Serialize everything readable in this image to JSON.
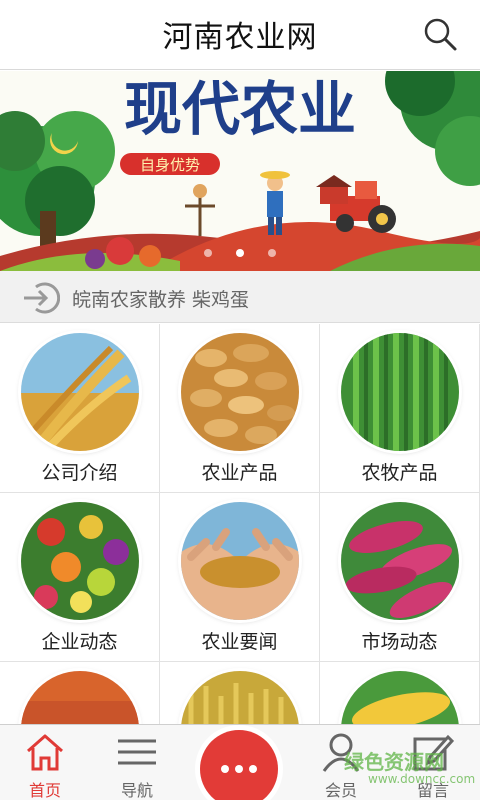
{
  "header": {
    "title": "河南农业网",
    "search_icon": "search-icon"
  },
  "banner": {
    "headline": "现代农业",
    "subheading": "自身优势",
    "slide_count": 3,
    "active_slide": 1
  },
  "ticker": {
    "icon": "arrow-into-circle-icon",
    "text": "皖南农家散养 柴鸡蛋"
  },
  "grid": {
    "items": [
      {
        "label": "公司介绍",
        "image": "wheat-photo"
      },
      {
        "label": "农业产品",
        "image": "peanuts-photo"
      },
      {
        "label": "农牧产品",
        "image": "green-plant-photo"
      },
      {
        "label": "企业动态",
        "image": "fruit-photo"
      },
      {
        "label": "农业要闻",
        "image": "grain-in-hands-photo"
      },
      {
        "label": "市场动态",
        "image": "sweet-potato-photo"
      },
      {
        "label": "",
        "image": "red-grain-photo"
      },
      {
        "label": "",
        "image": "rice-field-photo"
      },
      {
        "label": "",
        "image": "corn-photo"
      }
    ]
  },
  "bottom_nav": {
    "items": [
      {
        "label": "首页",
        "icon": "home-icon",
        "active": true
      },
      {
        "label": "导航",
        "icon": "menu-icon",
        "active": false
      },
      {
        "label": "会员",
        "icon": "user-icon",
        "active": false
      },
      {
        "label": "留言",
        "icon": "edit-icon",
        "active": false
      }
    ],
    "center_button_icon": "more-dots-icon"
  },
  "watermark": {
    "line1": "绿色资源网",
    "line2": "www.downcc.com"
  },
  "colors": {
    "accent": "#e23b37",
    "nav_active": "#e03a36",
    "ticker_bg": "#f1f1f1"
  }
}
